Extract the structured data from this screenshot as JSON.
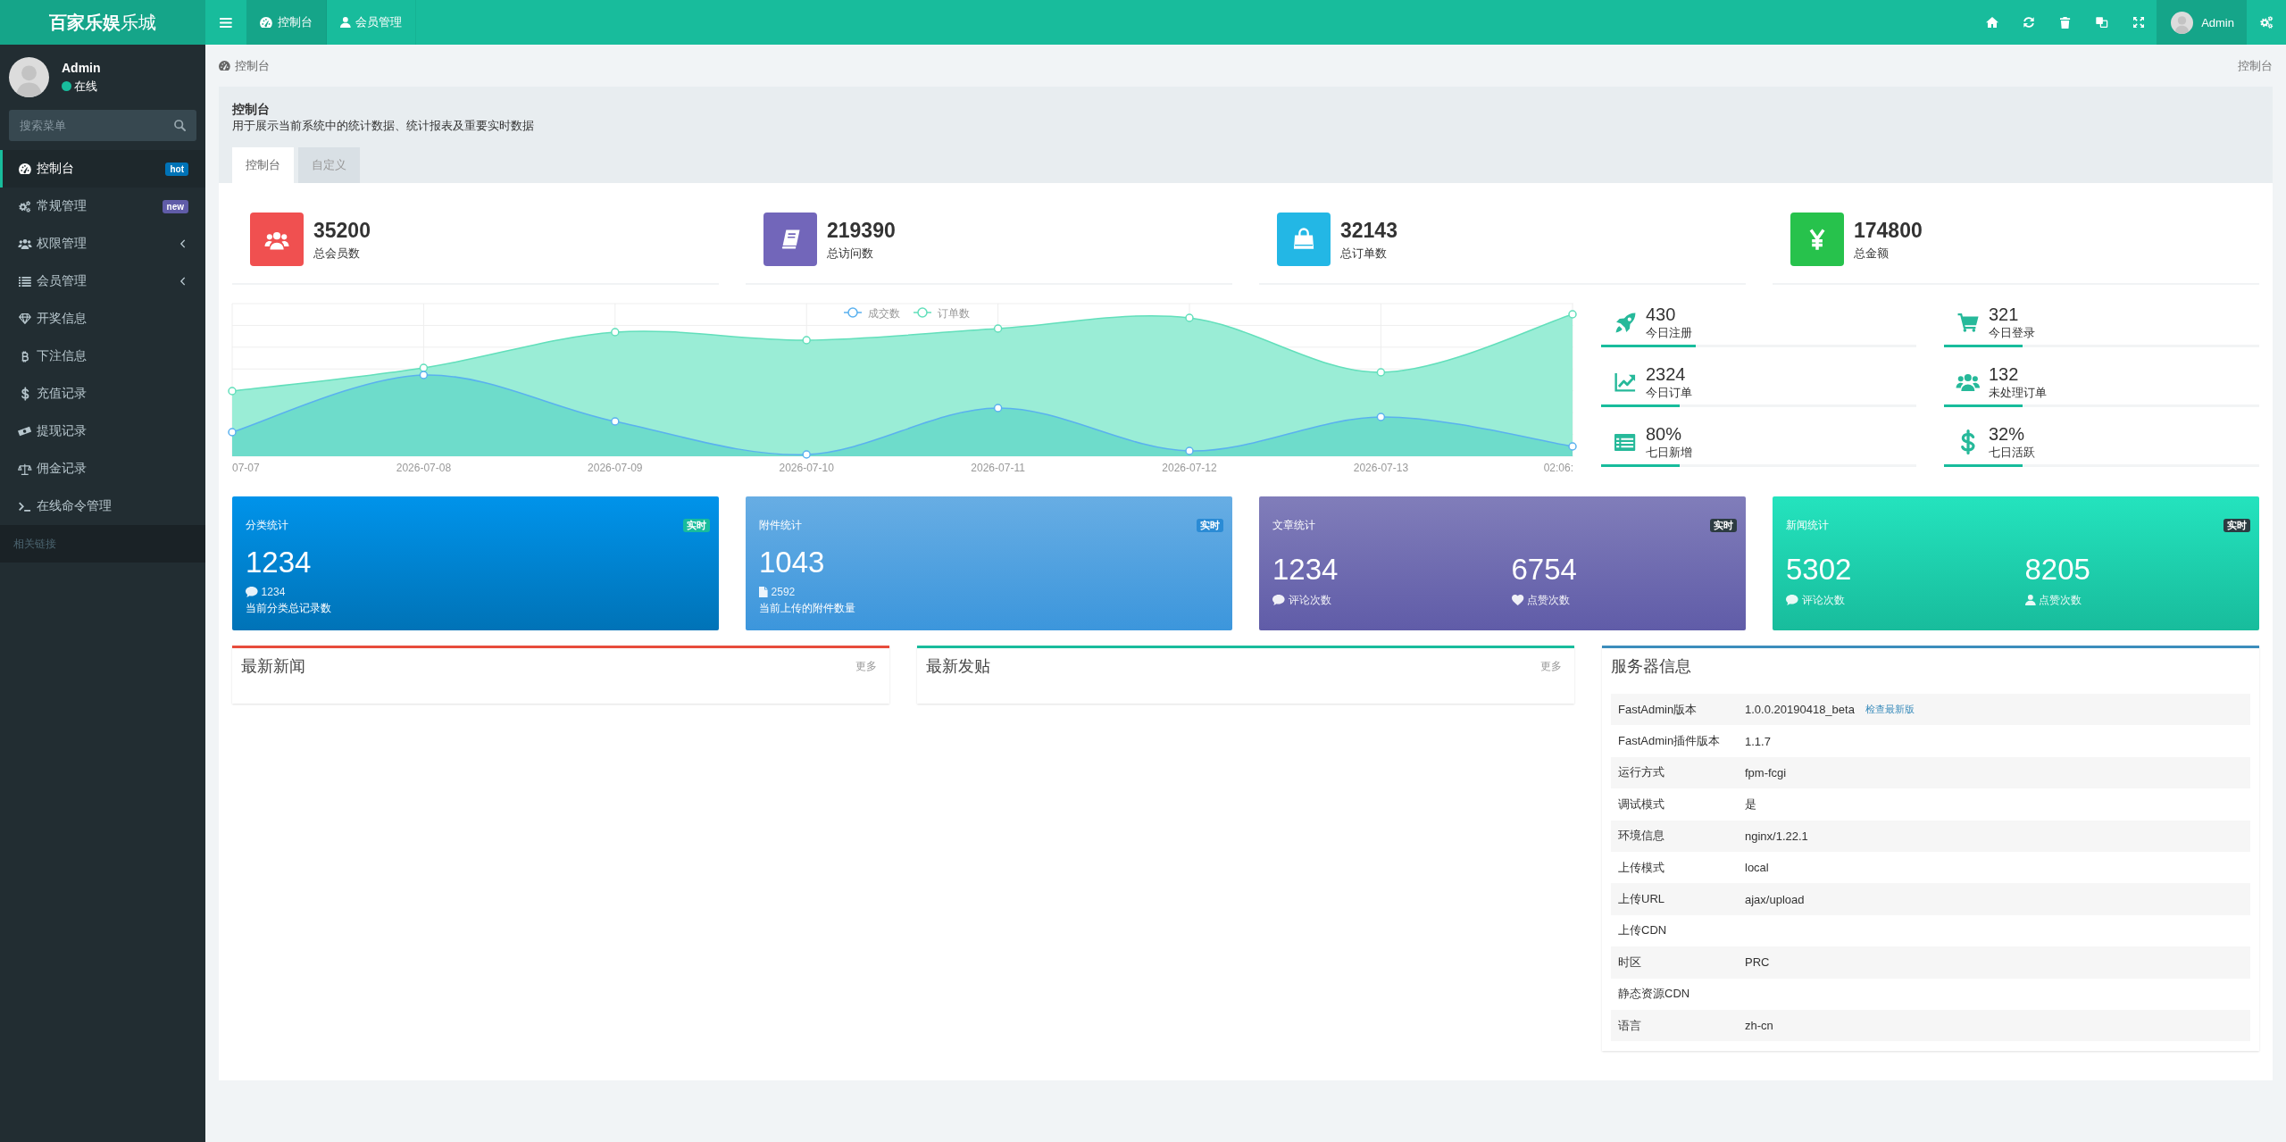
{
  "brand": "**百家乐娱**乐城",
  "topbar": {
    "tabs": [
      {
        "label": "控制台",
        "selected": true
      },
      {
        "label": "会员管理",
        "selected": false
      }
    ],
    "user": {
      "name": "Admin"
    }
  },
  "sidebar": {
    "user": {
      "name": "Admin",
      "status": "在线",
      "online": true
    },
    "search": {
      "placeholder": "搜索菜单"
    },
    "items": [
      {
        "label": "控制台",
        "selected": true,
        "submenu": false,
        "badge": {
          "text": "hot",
          "color": "#0073b7"
        }
      },
      {
        "label": "常规管理",
        "selected": false,
        "submenu": false,
        "badge": {
          "text": "new",
          "color": "#605ca8"
        }
      },
      {
        "label": "权限管理",
        "selected": false,
        "submenu": true
      },
      {
        "label": "会员管理",
        "selected": false,
        "submenu": true
      },
      {
        "label": "开奖信息",
        "selected": false,
        "submenu": false
      },
      {
        "label": "下注信息",
        "selected": false,
        "submenu": false
      },
      {
        "label": "充值记录",
        "selected": false,
        "submenu": false
      },
      {
        "label": "提现记录",
        "selected": false,
        "submenu": false
      },
      {
        "label": "佣金记录",
        "selected": false,
        "submenu": false
      },
      {
        "label": "在线命令管理",
        "selected": false,
        "submenu": false
      }
    ],
    "section_header": "相关链接"
  },
  "breadcrumb": {
    "current": "控制台",
    "right": "控制台"
  },
  "panel": {
    "title": "控制台",
    "description": "用于展示当前系统中的统计数据、统计报表及重要实时数据",
    "tabs": [
      {
        "label": "控制台",
        "selected": true
      },
      {
        "label": "自定义",
        "selected": false
      }
    ]
  },
  "stats": [
    {
      "value": "35200",
      "label": "总会员数",
      "color": "#f05050"
    },
    {
      "value": "219390",
      "label": "总访问数",
      "color": "#7266ba"
    },
    {
      "value": "32143",
      "label": "总订单数",
      "color": "#23b7e5"
    },
    {
      "value": "174800",
      "label": "总金额",
      "color": "#27c24c"
    }
  ],
  "chart": {
    "legend": [
      {
        "name": "成交数",
        "color": "#5ab1ef"
      },
      {
        "name": "订单数",
        "color": "#62dfbb"
      }
    ],
    "x_labels": [
      "07-07",
      "2026-07-08",
      "2026-07-09",
      "2026-07-10",
      "2026-07-11",
      "2026-07-12",
      "2026-07-13",
      "02:06:"
    ]
  },
  "mini_stats": [
    {
      "value": "430",
      "label": "今日注册",
      "level": 0.3
    },
    {
      "value": "321",
      "label": "今日登录",
      "level": 0.25
    },
    {
      "value": "2324",
      "label": "今日订单",
      "level": 0.25
    },
    {
      "value": "132",
      "label": "未处理订单",
      "level": 0.25
    },
    {
      "value": "80%",
      "label": "七日新增",
      "level": 0.25
    },
    {
      "value": "32%",
      "label": "七日活跃",
      "level": 0.25
    }
  ],
  "info_boxes": [
    {
      "kind": "single",
      "title": "分类统计",
      "color": "#0073b7",
      "badge": {
        "text": "实时",
        "color": "#18bc9c"
      },
      "value": "1234",
      "detail": "1234",
      "note": "当前分类总记录数"
    },
    {
      "kind": "single",
      "title": "附件统计",
      "color": "#3c96dc",
      "badge": {
        "text": "实时",
        "color": "#2a8bd5"
      },
      "value": "1043",
      "detail": "2592",
      "note": "当前上传的附件数量"
    },
    {
      "kind": "double",
      "title": "文章统计",
      "color": "#605ca8",
      "badge": {
        "text": "实时",
        "color": "#2c3b41"
      },
      "columns": [
        {
          "value": "1234",
          "label": "评论次数"
        },
        {
          "value": "6754",
          "label": "点赞次数"
        }
      ]
    },
    {
      "kind": "double",
      "title": "新闻统计",
      "color": "#18bc9c",
      "badge": {
        "text": "实时",
        "color": "#2c3b41"
      },
      "columns": [
        {
          "value": "5302",
          "label": "评论次数"
        },
        {
          "value": "8205",
          "label": "点赞次数"
        }
      ]
    }
  ],
  "news_boxes": [
    {
      "title": "最新新闻",
      "more": "更多",
      "color": "#e74c3c"
    },
    {
      "title": "最新发贴",
      "more": "更多",
      "color": "#18bc9c"
    }
  ],
  "server_info": {
    "title": "服务器信息",
    "color": "#3c8dbc",
    "rows": [
      {
        "label": "FastAdmin版本",
        "value": "1.0.0.20190418_beta",
        "link": "检查最新版"
      },
      {
        "label": "FastAdmin插件版本",
        "value": "1.1.7"
      },
      {
        "label": "运行方式",
        "value": "fpm-fcgi"
      },
      {
        "label": "调试模式",
        "value": "是"
      },
      {
        "label": "环境信息",
        "value": "nginx/1.22.1"
      },
      {
        "label": "上传模式",
        "value": "local"
      },
      {
        "label": "上传URL",
        "value": "ajax/upload"
      },
      {
        "label": "上传CDN"
      },
      {
        "label": "时区",
        "value": "PRC"
      },
      {
        "label": "静态资源CDN"
      },
      {
        "label": "语言",
        "value": "zh-cn"
      }
    ]
  }
}
